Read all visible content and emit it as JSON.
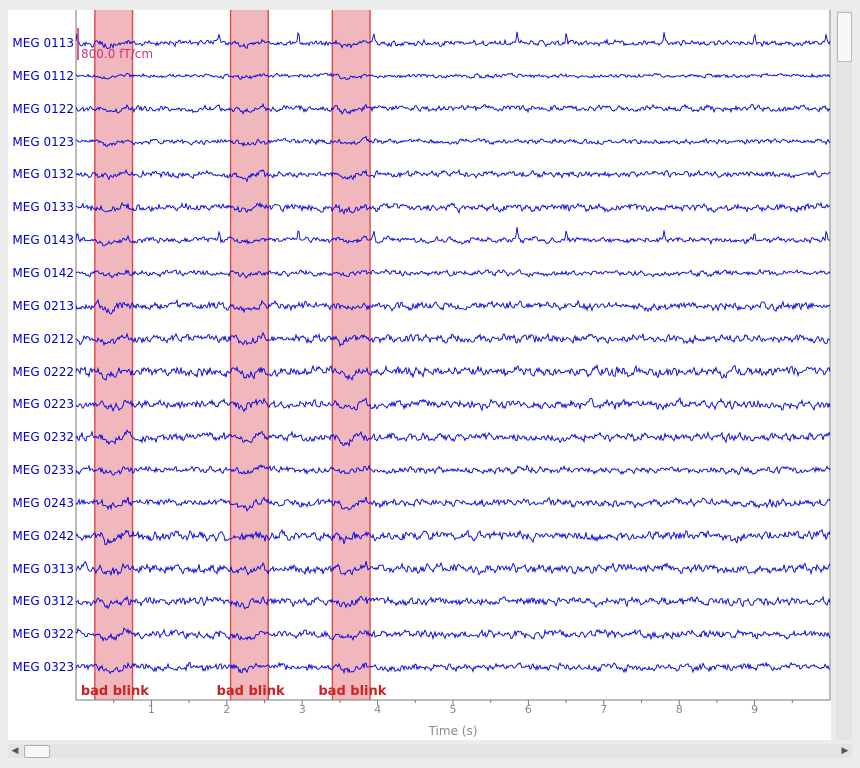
{
  "channels": [
    {
      "name": "MEG 0113",
      "spiky": true,
      "amp": 1.8,
      "seed": 11
    },
    {
      "name": "MEG 0112",
      "spiky": false,
      "amp": 1.3,
      "seed": 23
    },
    {
      "name": "MEG 0122",
      "spiky": false,
      "amp": 2.0,
      "seed": 37
    },
    {
      "name": "MEG 0123",
      "spiky": false,
      "amp": 1.6,
      "seed": 41
    },
    {
      "name": "MEG 0132",
      "spiky": false,
      "amp": 2.0,
      "seed": 53
    },
    {
      "name": "MEG 0133",
      "spiky": false,
      "amp": 2.4,
      "seed": 67
    },
    {
      "name": "MEG 0143",
      "spiky": true,
      "amp": 1.8,
      "seed": 71
    },
    {
      "name": "MEG 0142",
      "spiky": false,
      "amp": 1.8,
      "seed": 83
    },
    {
      "name": "MEG 0213",
      "spiky": false,
      "amp": 2.6,
      "seed": 97
    },
    {
      "name": "MEG 0212",
      "spiky": false,
      "amp": 2.6,
      "seed": 101
    },
    {
      "name": "MEG 0222",
      "spiky": false,
      "amp": 3.0,
      "seed": 113
    },
    {
      "name": "MEG 0223",
      "spiky": false,
      "amp": 2.8,
      "seed": 127
    },
    {
      "name": "MEG 0232",
      "spiky": false,
      "amp": 2.6,
      "seed": 131
    },
    {
      "name": "MEG 0233",
      "spiky": false,
      "amp": 2.2,
      "seed": 149
    },
    {
      "name": "MEG 0243",
      "spiky": false,
      "amp": 2.4,
      "seed": 151
    },
    {
      "name": "MEG 0242",
      "spiky": false,
      "amp": 3.0,
      "seed": 163
    },
    {
      "name": "MEG 0313",
      "spiky": false,
      "amp": 3.0,
      "seed": 173
    },
    {
      "name": "MEG 0312",
      "spiky": false,
      "amp": 2.6,
      "seed": 181
    },
    {
      "name": "MEG 0322",
      "spiky": false,
      "amp": 2.6,
      "seed": 191
    },
    {
      "name": "MEG 0323",
      "spiky": false,
      "amp": 2.4,
      "seed": 199
    }
  ],
  "annotations": [
    {
      "label": "bad blink",
      "onset": 0.25,
      "end": 0.75
    },
    {
      "label": "bad blink",
      "onset": 2.05,
      "end": 2.55
    },
    {
      "label": "bad blink",
      "onset": 3.4,
      "end": 3.9
    }
  ],
  "scale_bar_label": "800.0 fT/cm",
  "x_axis": {
    "label": "Time (s)",
    "xlim": [
      0,
      10
    ],
    "ticks": [
      1,
      2,
      3,
      4,
      5,
      6,
      7,
      8,
      9
    ]
  },
  "colors": {
    "trace": "#0000dd",
    "label": "#0000cc",
    "annotation_fill": "#f0b8bd",
    "annotation_edge": "#e04848",
    "annotation_text": "#cc2222",
    "scale_bar": "#cc3377",
    "axis": "#888888"
  },
  "icons": {
    "scroll_left": "triangle-left-icon",
    "scroll_right": "triangle-right-icon"
  }
}
